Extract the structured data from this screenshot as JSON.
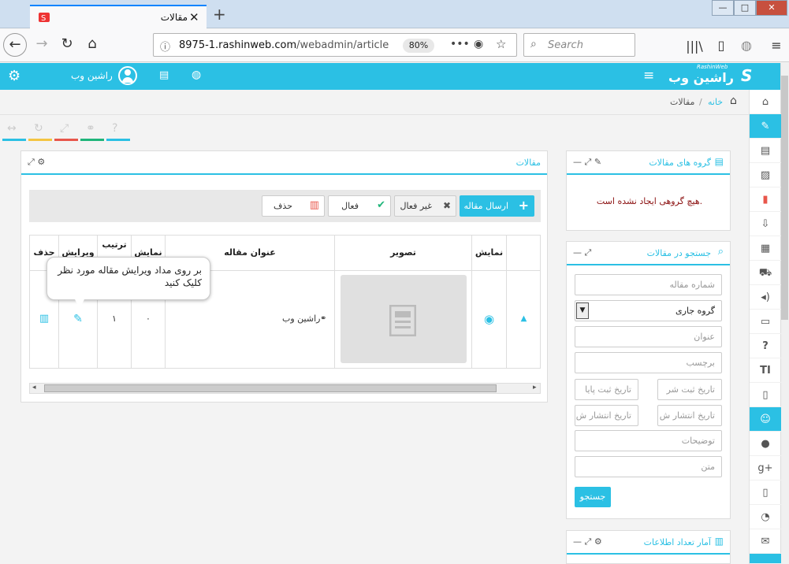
{
  "browser": {
    "tab_title": "مقالات",
    "url_domain": "8975-1.rashinweb.com",
    "url_path": "/webadmin/article",
    "zoom": "80%",
    "search_placeholder": "Search"
  },
  "header": {
    "user_name": "راشین وب",
    "logo_text": "راشین وب",
    "logo_sub": "RashinWeb"
  },
  "breadcrumb": {
    "home": "خانه",
    "sep": "/",
    "current": "مقالات"
  },
  "articles_panel": {
    "title": "مقالات",
    "buttons": {
      "send": "ارسال مقاله",
      "inactive": "غیر فعال",
      "active": "فعال",
      "delete": "حذف"
    },
    "columns": [
      "حذف",
      "ویرایش",
      "ترتیب",
      "نمایش",
      "عنوان مقاله",
      "تصویر",
      "نمایش"
    ],
    "rows": [
      {
        "title": "راشین وب",
        "order_num": "۰",
        "priority": "۱"
      }
    ],
    "tooltip": "بر روی مداد ویرایش مقاله مورد نظر کلیک کنید"
  },
  "groups_panel": {
    "title": "گروه های مقالات",
    "empty_message": "هیچ گروهی ایجاد نشده است."
  },
  "search_panel": {
    "title": "جستجو در مقالات",
    "fields": {
      "article_number": "شماره مقاله",
      "group_select": "گروه جاری",
      "title": "عنوان",
      "tag": "برچسب",
      "reg_date_from": "تاریخ ثبت شر",
      "reg_date_to": "تاریخ ثبت پایا",
      "pub_date_from": "تاریخ انتشار ش",
      "pub_date_to": "تاریخ انتشار ش",
      "description": "توضیحات",
      "text": "متن"
    },
    "search_button": "جستجو"
  },
  "stats_panel": {
    "title": "آمار تعداد اطلاعات"
  },
  "colors": {
    "accent": "#2bc0e4",
    "tool_lines": [
      "#2bc0e4",
      "#f4c542",
      "#e8564b",
      "#1fb57a",
      "#2bc0e4"
    ]
  }
}
